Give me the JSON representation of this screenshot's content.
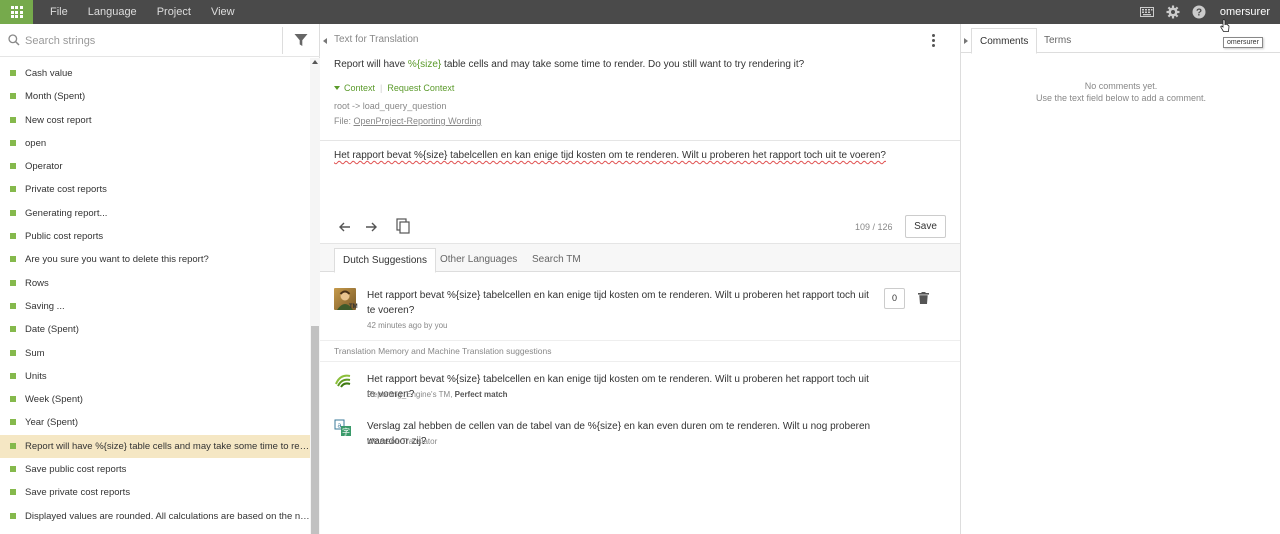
{
  "menu": {
    "items": [
      "File",
      "Language",
      "Project",
      "View"
    ]
  },
  "user": {
    "name": "omersurer",
    "tooltip": "omersurer"
  },
  "search": {
    "placeholder": "Search strings"
  },
  "strings": [
    "Cash value",
    "Month (Spent)",
    "New cost report",
    "open",
    "Operator",
    "Private cost reports",
    "Generating report...",
    "Public cost reports",
    "Are you sure you want to delete this report?",
    "Rows",
    "Saving ...",
    "Date (Spent)",
    "Sum",
    "Units",
    "Week (Spent)",
    "Year (Spent)",
    "Report will have %{size} table cells and may take some time to rende...",
    "Save public cost reports",
    "Save private cost reports",
    "Displayed values are rounded. All calculations are based on the non..."
  ],
  "selected_index": 16,
  "editor": {
    "heading": "Text for Translation",
    "source_before": "Report will have ",
    "source_placeholder": "%{size}",
    "source_after": " table cells and may take some time to render. Do you still want to try rendering it?",
    "context_label": "Context",
    "request_context": "Request Context",
    "context_key": "root -> load_query_question",
    "file_label": "File: ",
    "file_name": "OpenProject-Reporting Wording",
    "translation": "Het rapport bevat %{size} tabelcellen en kan enige tijd kosten om te renderen. Wilt u proberen het rapport toch uit te voeren?",
    "counter": "109 / 126",
    "save_label": "Save"
  },
  "tabs": [
    "Dutch Suggestions",
    "Other Languages",
    "Search TM"
  ],
  "suggestion": {
    "text": "Het rapport bevat %{size} tabelcellen en kan enige tijd kosten om te renderen. Wilt u proberen het rapport toch uit te voeren?",
    "meta": "42 minutes ago by you",
    "votes": "0"
  },
  "tm_heading": "Translation Memory and Machine Translation suggestions",
  "tm": [
    {
      "text": "Het rapport bevat %{size} tabelcellen en kan enige tijd kosten om te renderen. Wilt u proberen het rapport toch uit te voeren?",
      "source": "Reporting_Engine's TM",
      "match": "Perfect match"
    },
    {
      "text": "Verslag zal hebben de cellen van de tabel van de %{size} en kan even duren om te renderen. Wilt u nog proberen waardoor zij?",
      "source": "Microsoft Translator",
      "match": ""
    }
  ],
  "right_tabs": [
    "Comments",
    "Terms"
  ],
  "comments": {
    "empty_line1": "No comments yet.",
    "empty_line2": "Use the text field below to add a comment."
  },
  "colors": {
    "accent": "#76aa4c",
    "topbar": "#4a4a4a",
    "selected_row": "#f5e7c4",
    "placeholder_green": "#5a9a2a"
  }
}
